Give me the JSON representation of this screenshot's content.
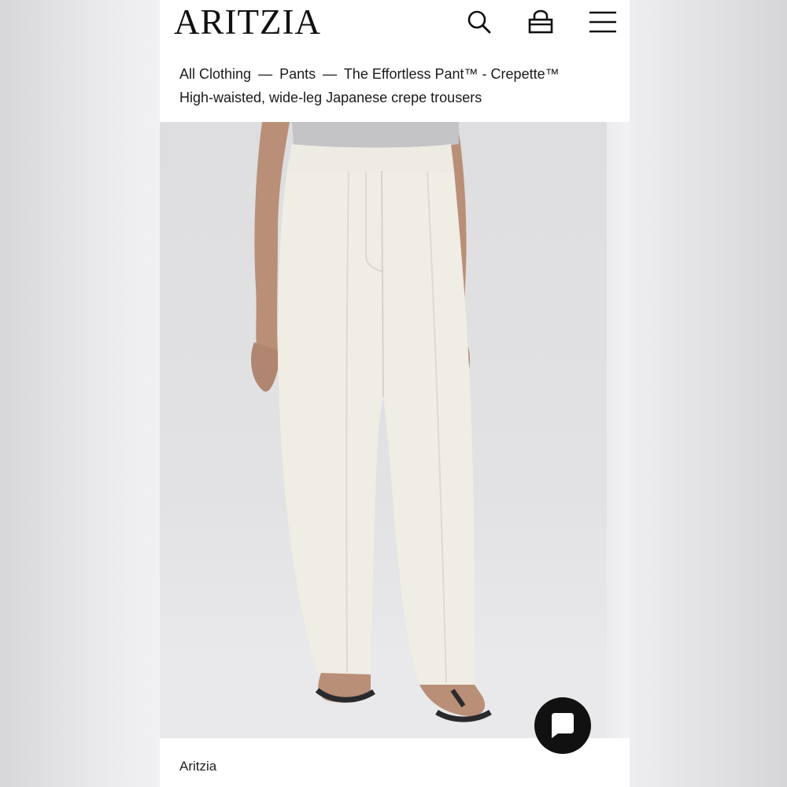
{
  "header": {
    "logo": "ARITZIA",
    "icons": [
      "search-icon",
      "bag-icon",
      "menu-icon"
    ]
  },
  "breadcrumb": {
    "items": [
      "All Clothing",
      "—",
      "Pants",
      "—",
      "The Effortless Pant™ - Crepette™"
    ]
  },
  "product": {
    "subtitle": "High-waisted, wide-leg Japanese crepe trousers",
    "brand": "Aritzia"
  },
  "chat": {
    "icon": "chat-bubble-icon"
  },
  "colors": {
    "background": "#ffffff",
    "text": "#1a1a1a",
    "chat_button": "#111111",
    "product_color": "#efece4"
  }
}
